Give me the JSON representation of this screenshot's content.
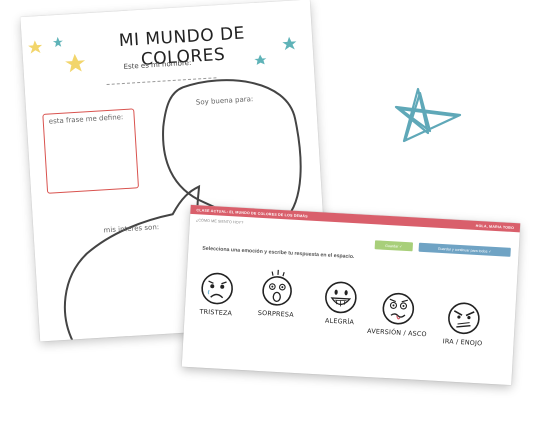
{
  "worksheet": {
    "title": "MI MUNDO DE COLORES",
    "name_label": "Este es mi nombre:",
    "phrase_label": "esta frase me define:",
    "good_at_label": "Soy buena para:",
    "interests_label": "mis interes son:"
  },
  "app": {
    "header_left": "CLASE ACTUAL: EL MUNDO DE COLORES DE LOS DEMÁS",
    "header_right": "HOLA, MARIA TOBO",
    "question": "¿CÓMO ME SIENTO HOY?",
    "save_button": "Guardar ✓",
    "continue_button": "Guardar y continuar para todos ✓",
    "instruction": "Selecciona una emoción y escribe tu respuesta en el espacio.",
    "emotions": [
      {
        "label": "TRISTEZA",
        "icon": "sad-face-icon"
      },
      {
        "label": "SORPRESA",
        "icon": "surprised-face-icon"
      },
      {
        "label": "ALEGRÍA",
        "icon": "happy-face-icon"
      },
      {
        "label": "AVERSIÓN / ASCO",
        "icon": "disgust-face-icon"
      },
      {
        "label": "IRA / ENOJO",
        "icon": "angry-face-icon"
      }
    ]
  },
  "colors": {
    "header_bar": "#d95f6b",
    "save_button": "#a8cf7a",
    "continue_button": "#6fa3c4",
    "phrase_box": "#d9534f",
    "star_yellow": "#f2d56b",
    "star_teal": "#5fb3b8",
    "scribble_star": "#5fa8b8"
  }
}
